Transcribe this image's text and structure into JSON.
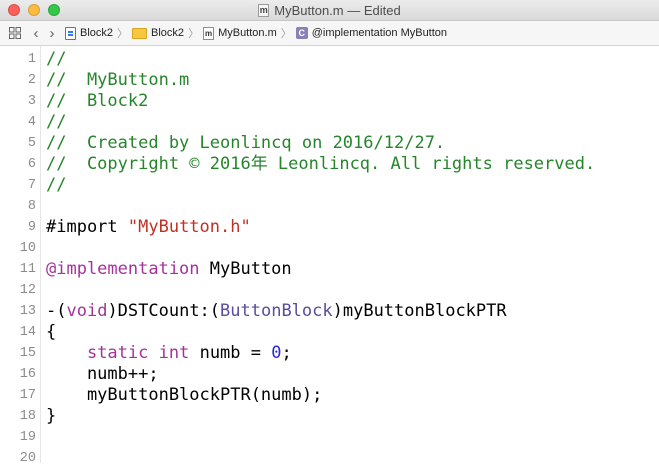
{
  "window": {
    "title": "MyButton.m — Edited",
    "file_icon_letter": "m"
  },
  "jumpbar": {
    "crumbs": [
      {
        "label": "Block2",
        "icon": "project-icon"
      },
      {
        "label": "Block2",
        "icon": "folder-icon"
      },
      {
        "label": "MyButton.m",
        "icon": "objc-file-icon",
        "icon_letter": "m"
      },
      {
        "label": "@implementation MyButton",
        "icon": "class-c-icon",
        "icon_letter": "C"
      }
    ]
  },
  "colors": {
    "comment": "#26852b",
    "keyword": "#a5329c",
    "string": "#c22f23",
    "number": "#2629d6",
    "type": "#5a4b9e"
  },
  "lines": [
    {
      "n": "1",
      "tokens": [
        {
          "t": "//",
          "c": "comment"
        }
      ]
    },
    {
      "n": "2",
      "tokens": [
        {
          "t": "//  MyButton.m",
          "c": "comment"
        }
      ]
    },
    {
      "n": "3",
      "tokens": [
        {
          "t": "//  Block2",
          "c": "comment"
        }
      ]
    },
    {
      "n": "4",
      "tokens": [
        {
          "t": "//",
          "c": "comment"
        }
      ]
    },
    {
      "n": "5",
      "tokens": [
        {
          "t": "//  Created by Leonlincq on 2016/12/27.",
          "c": "comment"
        }
      ]
    },
    {
      "n": "6",
      "tokens": [
        {
          "t": "//  Copyright © 2016年 Leonlincq. All rights reserved.",
          "c": "comment"
        }
      ]
    },
    {
      "n": "7",
      "tokens": [
        {
          "t": "//",
          "c": "comment"
        }
      ]
    },
    {
      "n": "8",
      "tokens": []
    },
    {
      "n": "9",
      "tokens": [
        {
          "t": "#import ",
          "c": "plain"
        },
        {
          "t": "\"MyButton.h\"",
          "c": "string"
        }
      ]
    },
    {
      "n": "10",
      "tokens": []
    },
    {
      "n": "11",
      "tokens": [
        {
          "t": "@implementation",
          "c": "keyword"
        },
        {
          "t": " MyButton",
          "c": "plain"
        }
      ]
    },
    {
      "n": "12",
      "tokens": []
    },
    {
      "n": "13",
      "tokens": [
        {
          "t": "-(",
          "c": "plain"
        },
        {
          "t": "void",
          "c": "keyword"
        },
        {
          "t": ")DSTCount:(",
          "c": "plain"
        },
        {
          "t": "ButtonBlock",
          "c": "type"
        },
        {
          "t": ")myButtonBlockPTR",
          "c": "plain"
        }
      ]
    },
    {
      "n": "14",
      "tokens": [
        {
          "t": "{",
          "c": "plain"
        }
      ]
    },
    {
      "n": "15",
      "tokens": [
        {
          "t": "    ",
          "c": "plain"
        },
        {
          "t": "static",
          "c": "keyword"
        },
        {
          "t": " ",
          "c": "plain"
        },
        {
          "t": "int",
          "c": "keyword"
        },
        {
          "t": " numb = ",
          "c": "plain"
        },
        {
          "t": "0",
          "c": "number"
        },
        {
          "t": ";",
          "c": "plain"
        }
      ]
    },
    {
      "n": "16",
      "tokens": [
        {
          "t": "    numb++;",
          "c": "plain"
        }
      ]
    },
    {
      "n": "17",
      "tokens": [
        {
          "t": "    myButtonBlockPTR(numb);",
          "c": "plain"
        }
      ]
    },
    {
      "n": "18",
      "tokens": [
        {
          "t": "}",
          "c": "plain"
        }
      ]
    },
    {
      "n": "19",
      "tokens": []
    },
    {
      "n": "20",
      "tokens": []
    }
  ]
}
